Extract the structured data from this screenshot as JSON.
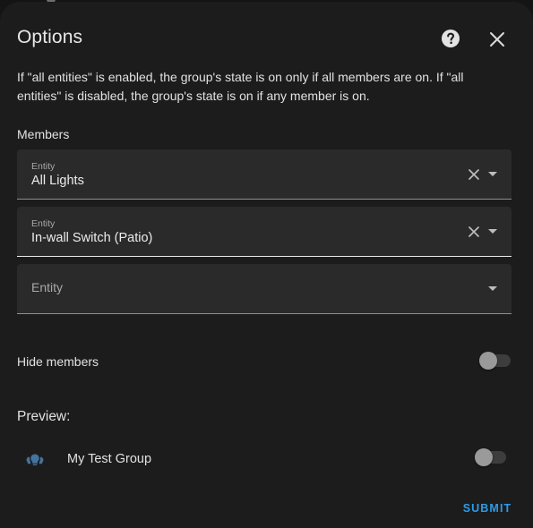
{
  "dialog": {
    "title": "Options",
    "description": "If \"all entities\" is enabled, the group's state is on only if all members are on. If \"all entities\" is disabled, the group's state is on if any member is on.",
    "icons": {
      "help": "help-circle-icon",
      "close": "close-icon"
    }
  },
  "members": {
    "label": "Members",
    "fields": [
      {
        "label": "Entity",
        "value": "All Lights",
        "focused": false
      },
      {
        "label": "Entity",
        "value": "In-wall Switch (Patio)",
        "focused": true
      },
      {
        "placeholder": "Entity"
      }
    ]
  },
  "hide_members": {
    "label": "Hide members",
    "enabled": false
  },
  "preview": {
    "label": "Preview:",
    "entity_name": "My Test Group",
    "entity_icon": "lightbulb-group-icon",
    "icon_color": "#44739e",
    "state_on": false
  },
  "actions": {
    "submit_label": "SUBMIT"
  },
  "colors": {
    "accent": "#2e9be9",
    "dialog_bg": "#1c1c1c",
    "field_bg": "#2a2a2a"
  }
}
